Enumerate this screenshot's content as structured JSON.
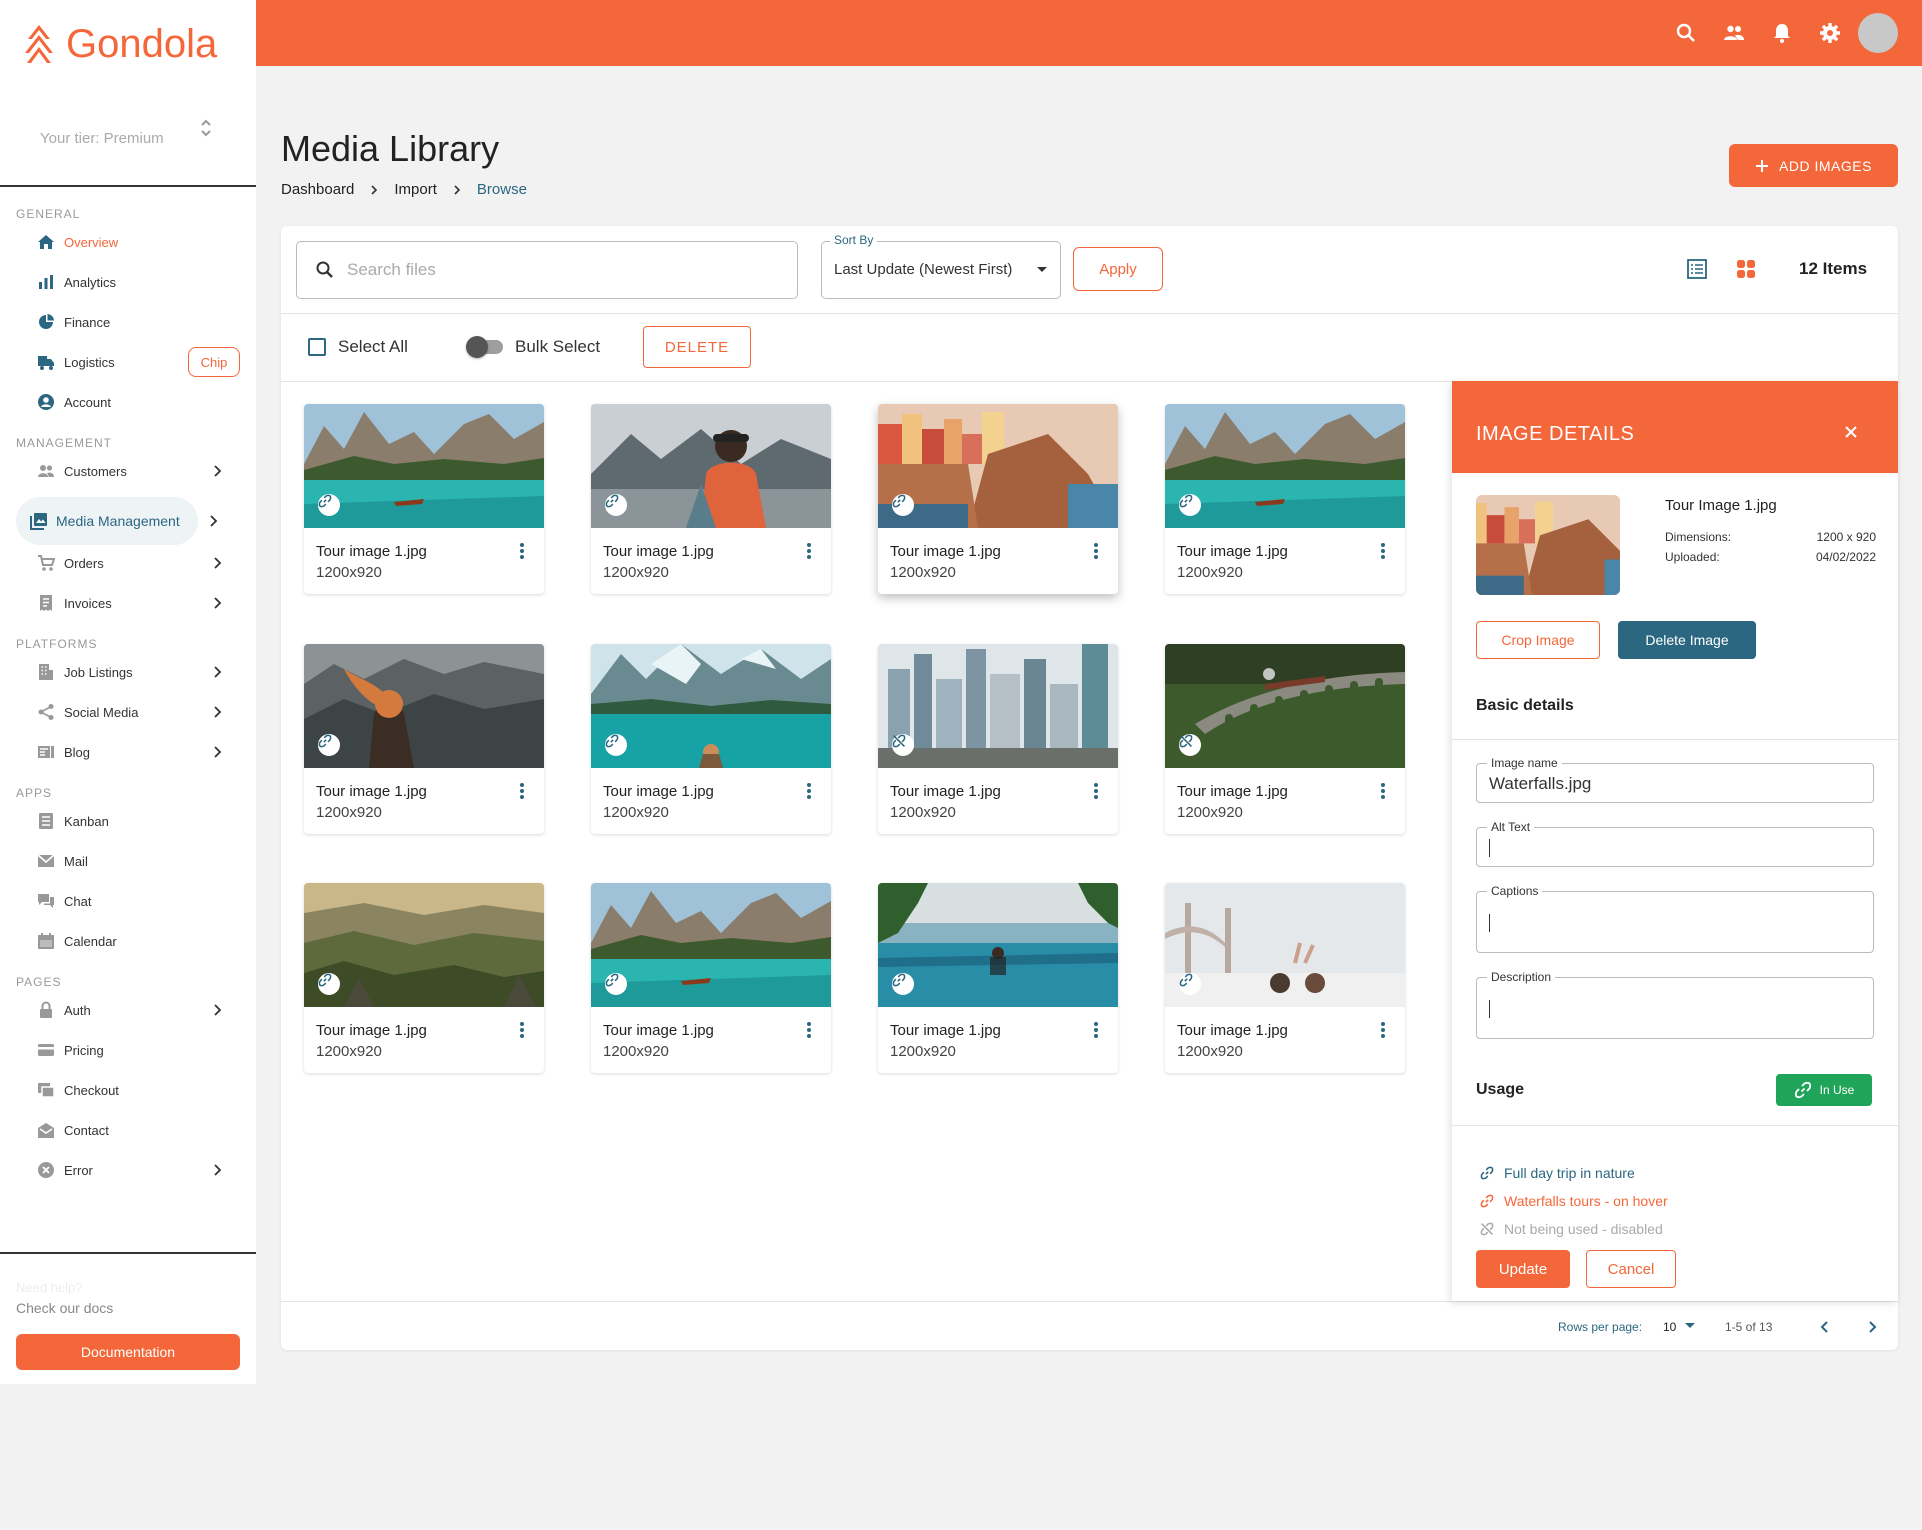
{
  "app": {
    "name": "Gondola",
    "tier": "Your tier: Premium"
  },
  "topbar": {
    "icons": [
      "search-icon",
      "users-icon",
      "bell-icon",
      "gear-icon",
      "avatar"
    ]
  },
  "sidebar": {
    "sections": [
      {
        "title": "GENERAL",
        "items": [
          {
            "label": "Overview",
            "icon": "home-icon",
            "active": true
          },
          {
            "label": "Analytics",
            "icon": "bar-chart-icon"
          },
          {
            "label": "Finance",
            "icon": "pie-chart-icon"
          },
          {
            "label": "Logistics",
            "icon": "truck-icon",
            "chip": "Chip"
          },
          {
            "label": "Account",
            "icon": "account-circle-icon"
          }
        ]
      },
      {
        "title": "MANAGEMENT",
        "items": [
          {
            "label": "Customers",
            "icon": "people-icon",
            "expandable": true
          },
          {
            "label": "Media Management",
            "icon": "image-gallery-icon",
            "expandable": true,
            "selected": true
          },
          {
            "label": "Orders",
            "icon": "cart-icon",
            "expandable": true
          },
          {
            "label": "Invoices",
            "icon": "receipt-icon",
            "expandable": true
          }
        ]
      },
      {
        "title": "PLATFORMS",
        "items": [
          {
            "label": "Job  Listings",
            "icon": "building-icon",
            "expandable": true
          },
          {
            "label": "Social  Media",
            "icon": "share-icon",
            "expandable": true
          },
          {
            "label": "Blog",
            "icon": "blog-icon",
            "expandable": true
          }
        ]
      },
      {
        "title": "APPS",
        "items": [
          {
            "label": "Kanban",
            "icon": "kanban-icon"
          },
          {
            "label": "Mail",
            "icon": "mail-icon"
          },
          {
            "label": "Chat",
            "icon": "chat-icon"
          },
          {
            "label": "Calendar",
            "icon": "calendar-icon"
          }
        ]
      },
      {
        "title": "PAGES",
        "items": [
          {
            "label": "Auth",
            "icon": "lock-icon",
            "expandable": true
          },
          {
            "label": "Pricing",
            "icon": "credit-card-icon"
          },
          {
            "label": "Checkout",
            "icon": "checkout-icon"
          },
          {
            "label": "Contact",
            "icon": "contact-mail-icon"
          },
          {
            "label": "Error",
            "icon": "error-icon",
            "expandable": true
          }
        ]
      }
    ],
    "help": "Need help?",
    "docs_text": "Check our docs",
    "docs_button": "Documentation"
  },
  "header": {
    "title": "Media Library",
    "breadcrumbs": [
      "Dashboard",
      "Import",
      "Browse"
    ],
    "add_button": "ADD IMAGES"
  },
  "toolbar": {
    "search_placeholder": "Search files",
    "sort_label": "Sort By",
    "sort_value": "Last Update (Newest First)",
    "apply": "Apply",
    "items_count": "12 Items",
    "select_all": "Select All",
    "bulk_select": "Bulk Select",
    "delete": "DELETE"
  },
  "tiles": [
    {
      "name": "Tour image 1.jpg",
      "size": "1200x920",
      "scene": "lake",
      "link": "linked"
    },
    {
      "name": "Tour image 1.jpg",
      "size": "1200x920",
      "scene": "hiker",
      "link": "linked"
    },
    {
      "name": "Tour image 1.jpg",
      "size": "1200x920",
      "scene": "village",
      "link": "linked"
    },
    {
      "name": "Tour image 1.jpg",
      "size": "1200x920",
      "scene": "lake",
      "link": "linked"
    },
    {
      "name": "Tour image 1.jpg",
      "size": "1200x920",
      "scene": "forest",
      "link": "linked"
    },
    {
      "name": "Tour image 1.jpg",
      "size": "1200x920",
      "scene": "glacier",
      "link": "linked"
    },
    {
      "name": "Tour image 1.jpg",
      "size": "1200x920",
      "scene": "city",
      "link": "unlinked"
    },
    {
      "name": "Tour image 1.jpg",
      "size": "1200x920",
      "scene": "viaduct",
      "link": "unlinked"
    },
    {
      "name": "Tour image 1.jpg",
      "size": "1200x920",
      "scene": "valley",
      "link": "linked"
    },
    {
      "name": "Tour image 1.jpg",
      "size": "1200x920",
      "scene": "lake",
      "link": "linked"
    },
    {
      "name": "Tour image 1.jpg",
      "size": "1200x920",
      "scene": "pool",
      "link": "linked"
    },
    {
      "name": "Tour image 1.jpg",
      "size": "1200x920",
      "scene": "bridge",
      "link": "linked"
    }
  ],
  "pagination": {
    "rows_label": "Rows per page:",
    "rows_value": "10",
    "range": "1-5 of 13"
  },
  "details": {
    "title": "IMAGE DETAILS",
    "file_name": "Tour Image 1.jpg",
    "dimensions_label": "Dimensions:",
    "dimensions_value": "1200 x 920",
    "uploaded_label": "Uploaded:",
    "uploaded_value": "04/02/2022",
    "crop": "Crop Image",
    "delete": "Delete Image",
    "basic_title": "Basic details",
    "fields": {
      "image_name_label": "Image name",
      "image_name_value": "Waterfalls.jpg",
      "alt_text_label": "Alt Text",
      "captions_label": "Captions",
      "description_label": "Description"
    },
    "usage_title": "Usage",
    "in_use": "In Use",
    "usage_links": [
      {
        "label": "Full day trip in nature",
        "color": "#2b6781"
      },
      {
        "label": "Waterfalls tours - on hover",
        "color": "#f4673a"
      },
      {
        "label": "Not being used - disabled",
        "color": "#aaaaaa"
      }
    ],
    "update": "Update",
    "cancel": "Cancel"
  },
  "colors": {
    "primary": "#f4673a",
    "secondary": "#2b6781",
    "success": "#1fa45a"
  }
}
